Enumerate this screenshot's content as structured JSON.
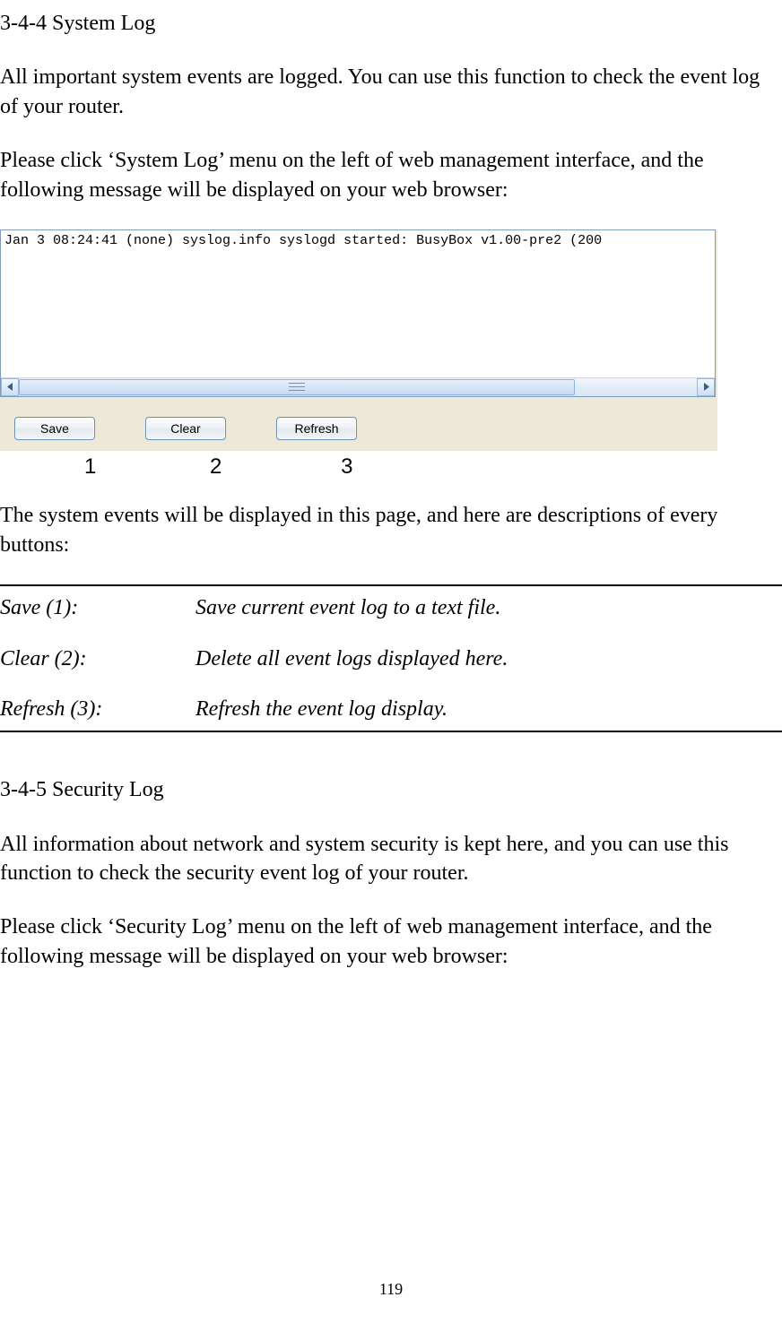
{
  "section_344_title": "3-4-4 System Log",
  "para_intro": "All important system events are logged. You can use this function to check the event log of your router.",
  "para_click_syslog": "Please click ‘System Log’ menu on the left of web management interface, and the following message will be displayed on your web browser:",
  "log_content": "Jan  3 08:24:41 (none) syslog.info syslogd started: BusyBox v1.00-pre2 (200",
  "buttons": {
    "save": "Save",
    "clear": "Clear",
    "refresh": "Refresh"
  },
  "callouts": {
    "c1": "1",
    "c2": "2",
    "c3": "3"
  },
  "para_events": "The system events will be displayed in this page, and here are descriptions of every buttons:",
  "desc": {
    "save_label": "Save (1):",
    "save_text": "Save current event log to a text file.",
    "clear_label": "Clear (2):",
    "clear_text": "Delete all event logs displayed here.",
    "refresh_label": "Refresh (3):",
    "refresh_text": "Refresh the event log display."
  },
  "section_345_title": "3-4-5 Security Log",
  "para_sec_intro": "All information about network and system security is kept here, and you can use this function to check the security event log of your router.",
  "para_click_seclog": "Please click ‘Security Log’ menu on the left of web management interface, and the following message will be displayed on your web browser:",
  "page_number": "119"
}
